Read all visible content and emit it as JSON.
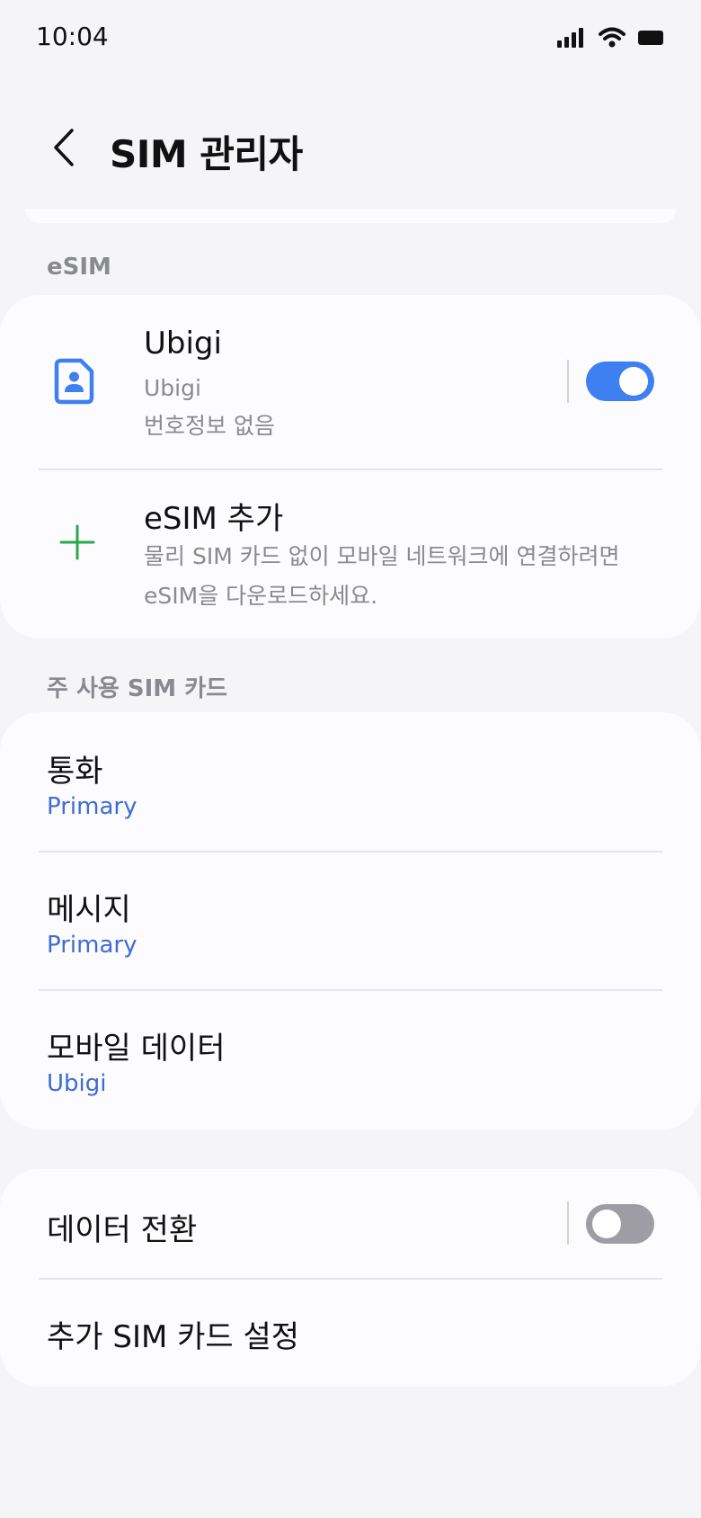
{
  "status_bar": {
    "time": "10:04",
    "icons": [
      "signal-icon",
      "wifi-icon",
      "battery-icon"
    ]
  },
  "header": {
    "back_icon": "chevron-left-icon",
    "title": "SIM 관리자"
  },
  "esim_section": {
    "label": "eSIM",
    "sim": {
      "icon": "sim-card-icon",
      "name": "Ubigi",
      "carrier": "Ubigi",
      "number": "번호정보 없음",
      "enabled": true
    },
    "add": {
      "icon": "plus-icon",
      "title": "eSIM 추가",
      "description_line1": "물리 SIM 카드 없이 모바일 네트워크에 연결하려면",
      "description_line2": "eSIM을 다운로드하세요."
    }
  },
  "primary_section": {
    "label": "주 사용 SIM 카드",
    "items": [
      {
        "title": "통화",
        "value": "Primary"
      },
      {
        "title": "메시지",
        "value": "Primary"
      },
      {
        "title": "모바일 데이터",
        "value": "Ubigi"
      }
    ]
  },
  "more_section": {
    "data_switch": {
      "title": "데이터 전환",
      "enabled": false
    },
    "more_settings": {
      "title": "추가 SIM 카드 설정"
    }
  },
  "colors": {
    "accent_blue": "#3e7ff2",
    "value_blue": "#3e6cd3",
    "plus_green": "#2aa84a",
    "toggle_off": "#9d9da3",
    "background": "#f5f5f7",
    "card": "#fcfcfe"
  }
}
